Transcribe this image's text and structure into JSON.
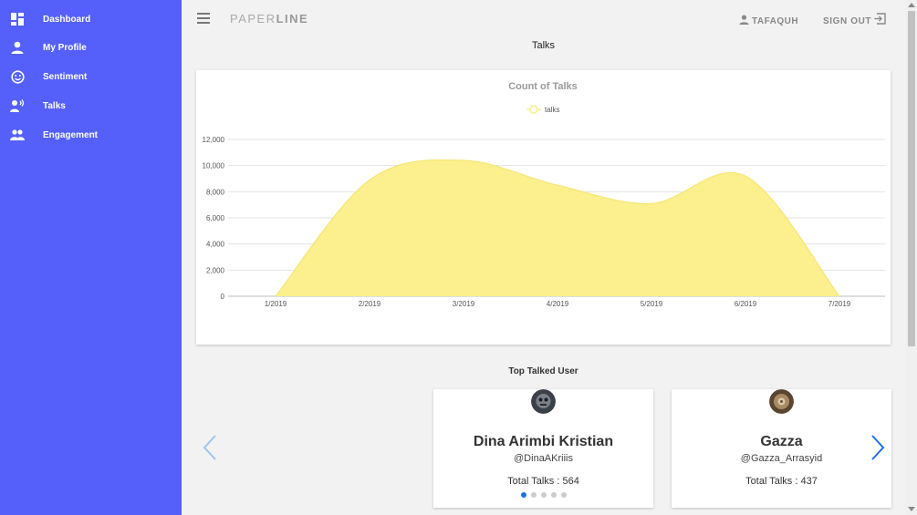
{
  "sidebar": {
    "items": [
      {
        "label": "Dashboard",
        "icon": "dashboard-icon"
      },
      {
        "label": "My Profile",
        "icon": "person-icon"
      },
      {
        "label": "Sentiment",
        "icon": "smiley-icon"
      },
      {
        "label": "Talks",
        "icon": "speaking-person-icon"
      },
      {
        "label": "Engagement",
        "icon": "people-icon"
      }
    ]
  },
  "header": {
    "brand_light": "PAPER",
    "brand_bold": "LINE",
    "user_label": "TAFAQUH",
    "signout_label": "SIGN OUT"
  },
  "page": {
    "title": "Talks",
    "section_title": "Top Talked User"
  },
  "chart_data": {
    "type": "area",
    "title": "Count of Talks",
    "categories": [
      "1/2019",
      "2/2019",
      "3/2019",
      "4/2019",
      "5/2019",
      "6/2019",
      "7/2019"
    ],
    "series": [
      {
        "name": "talks",
        "values": [
          0,
          8900,
          10400,
          8500,
          7100,
          9200,
          0
        ]
      }
    ],
    "ylim": [
      0,
      12000
    ],
    "yticks": [
      "0",
      "2,000",
      "4,000",
      "6,000",
      "8,000",
      "10,000",
      "12,000"
    ],
    "legend_position": "top",
    "grid": true,
    "color": "#fbee88"
  },
  "carousel": {
    "users": [
      {
        "name": "Dina Arimbi Kristian",
        "handle": "@DinaAKriiis",
        "total_talks": "Total Talks : 564"
      },
      {
        "name": "Gazza",
        "handle": "@Gazza_Arrasyid",
        "total_talks": "Total Talks : 437"
      }
    ],
    "dot_count": 5,
    "active_dot": 0
  },
  "colors": {
    "sidebar": "#5560fb",
    "accent": "#1e6ee8",
    "area_fill": "#fbee88"
  }
}
